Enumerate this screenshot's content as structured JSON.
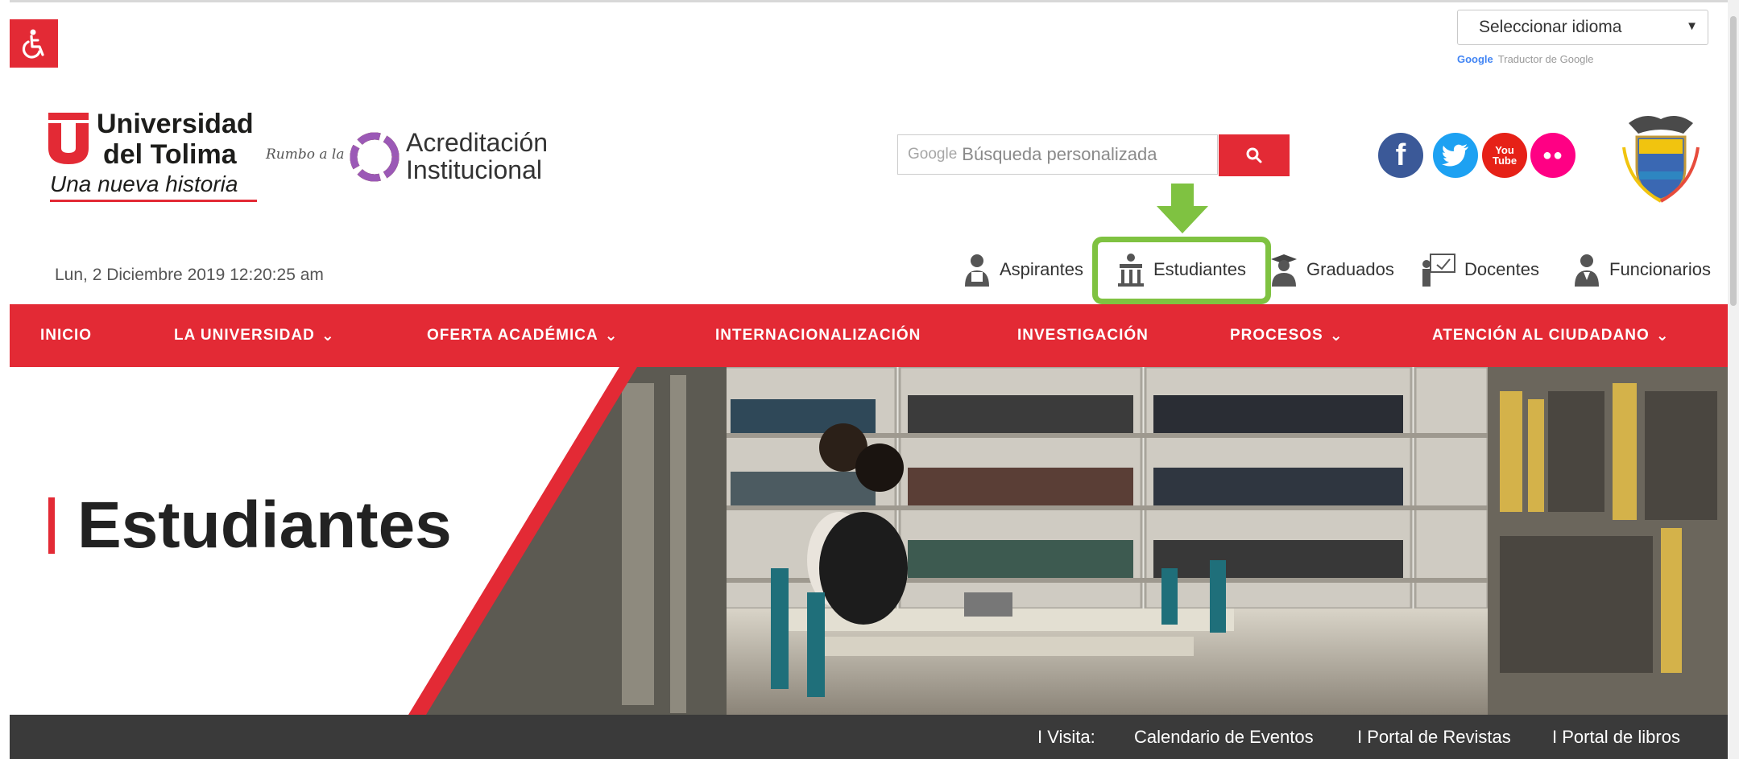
{
  "accessibility": {
    "icon": "wheelchair-icon",
    "color": "#e32a35"
  },
  "language": {
    "selected": "Seleccionar idioma",
    "powered_by_brand": "Google",
    "powered_by_text": "Traductor de Google"
  },
  "logo": {
    "name_line1": "Universidad",
    "name_line2": "del Tolima",
    "slogan": "Una nueva historia"
  },
  "accreditation": {
    "prefix": "Rumbo a la",
    "line1": "Acreditación",
    "line2": "Institucional"
  },
  "search": {
    "brand": "Google",
    "placeholder": "Búsqueda personalizada",
    "icon": "search-icon"
  },
  "social": [
    {
      "name": "facebook",
      "glyph": "f",
      "color": "#3b5998"
    },
    {
      "name": "twitter",
      "glyph": "t",
      "color": "#1da1f2"
    },
    {
      "name": "youtube",
      "glyph": "You Tube",
      "color": "#e62117"
    },
    {
      "name": "flickr",
      "glyph": "●●",
      "color": "#ff0084"
    }
  ],
  "datetime": "Lun, 2 Diciembre 2019 12:20:25 am",
  "roles": [
    {
      "label": "Aspirantes",
      "icon": "aspirant-icon"
    },
    {
      "label": "Estudiantes",
      "icon": "student-icon",
      "highlighted": true
    },
    {
      "label": "Graduados",
      "icon": "graduate-icon"
    },
    {
      "label": "Docentes",
      "icon": "teacher-icon"
    },
    {
      "label": "Funcionarios",
      "icon": "staff-icon"
    }
  ],
  "nav": [
    {
      "label": "INICIO",
      "dropdown": false
    },
    {
      "label": "LA UNIVERSIDAD",
      "dropdown": true
    },
    {
      "label": "OFERTA ACADÉMICA",
      "dropdown": true
    },
    {
      "label": "INTERNACIONALIZACIÓN",
      "dropdown": false
    },
    {
      "label": "INVESTIGACIÓN",
      "dropdown": false
    },
    {
      "label": "PROCESOS",
      "dropdown": true
    },
    {
      "label": "ATENCIÓN AL CIUDADANO",
      "dropdown": true
    }
  ],
  "hero": {
    "title": "Estudiantes"
  },
  "footer": {
    "visit_label": "I Visita:",
    "links": [
      "Calendario de Eventos",
      "I Portal de Revistas",
      "I Portal de libros"
    ]
  },
  "colors": {
    "brand_red": "#e32a35",
    "highlight_green": "#7fc241",
    "dark_bar": "#3a3a3a"
  }
}
